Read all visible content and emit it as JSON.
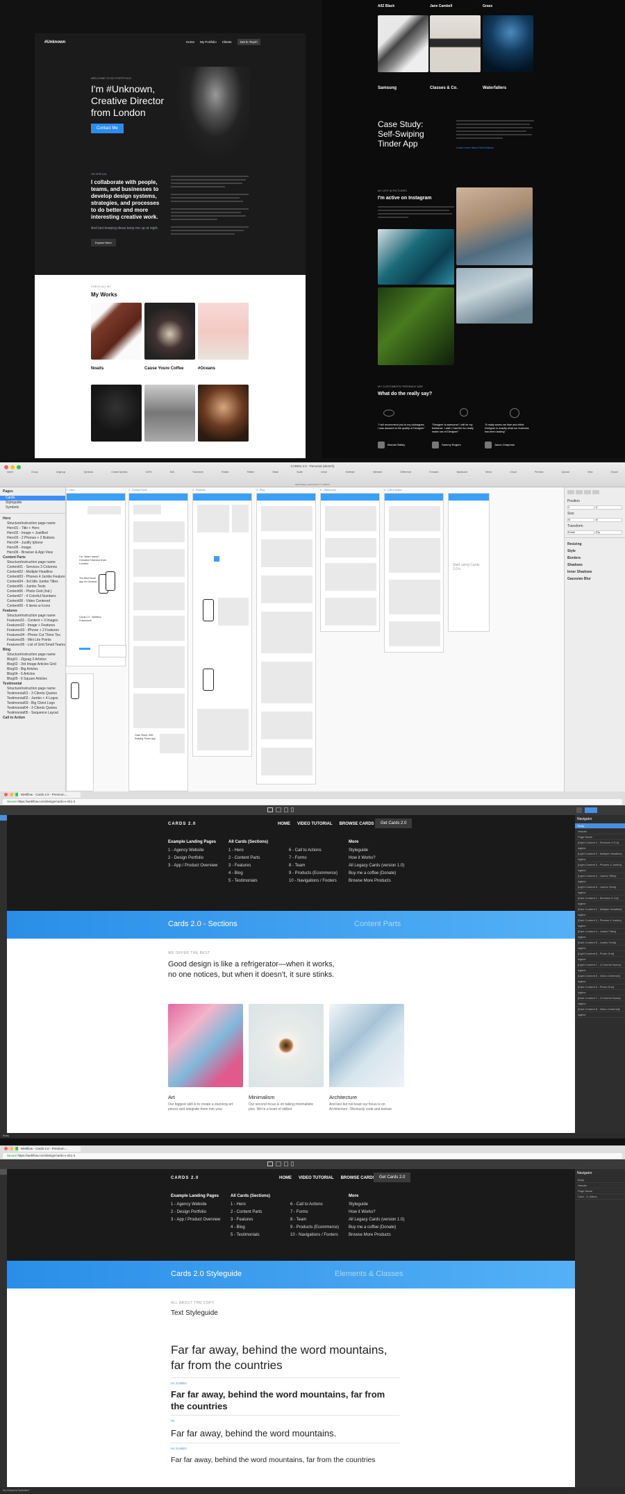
{
  "portfolio": {
    "brand": "#Unknown",
    "nav": [
      "Home",
      "My Portfolio",
      "Clients",
      "Get in Touch"
    ],
    "eyebrow": "WELCOME TO MY PORTFOLIO",
    "hero": "I'm #Unknown, Creative Director from London",
    "hero_btn": "Contact Me",
    "about_eyebrow": "I'M SPECIAL",
    "about_title": "I collaborate with people, teams, and businesses to develop design systems, strategies, and processes to do better and more interesting creative work.",
    "about_sub": "And last keeping ideas keep me up at night.",
    "about_btn": "Explore More",
    "works_eyebrow": "CHECK ALL MY",
    "works_title": "My Works",
    "works": [
      "Noaits",
      "Cause Youre Coffee",
      "#Oceans"
    ],
    "top_captions": [
      "A/IZ Black",
      "Jane Cambell",
      "Grass"
    ],
    "captions": [
      "Samsung",
      "Classes & Co.",
      "Waterfallers"
    ],
    "case_title": "Case Study: Self-Swiping Tinder App",
    "case_link": "Learn more about Self-Swipes",
    "insta_eyebrow": "MY LIFE IN PICTURES",
    "insta_title": "I'm active on Instagram",
    "reviews_eyebrow": "MY CUSTOMER'S FEEDBACK ARE",
    "reviews_title": "What do the really say?",
    "reviewers": [
      "Manuel Bailey",
      "Sammy Rogers",
      "Jason Chapman"
    ],
    "quotes": [
      "\"I will recommend you to my colleagues. I was amazed at the quality of Designer\"",
      "\"Designer is awesome! I will be my freelance. I wish I had the fun really made use of Designer\"",
      "\"It really saves me time and effort. Designer is exactly what our business has been lacking\""
    ]
  },
  "sketch": {
    "title": "CARDS 2.0 - Personal (Sketch)",
    "subtitle": "sketchapp.com/cards-2.0.sketch",
    "tools": [
      "Insert",
      "Group",
      "Ungroup",
      "Symbols",
      "Create Symbol",
      "Edit",
      "Transform",
      "Rotate",
      "Flatten",
      "Mask",
      "Scale",
      "Union",
      "Subtract",
      "Intersect",
      "Difference",
      "Forward",
      "Backward",
      "Mirror",
      "Cloud",
      "Preview",
      "Upload",
      "View",
      "Export"
    ],
    "zoom": "100%",
    "pages_label": "Pages",
    "pages": [
      "Cards",
      "Styleguide",
      "Symbols"
    ],
    "layers": [
      "Hero",
      "StructureInstruction page name",
      "Hero01 - Title + Hero",
      "Hero02 - Image + Justified",
      "Hero03 - 2 Phones + 2 Buttons",
      "Hero04 - Justify Iphone",
      "Hero05 - Image",
      "Hero06 - Browser & App View",
      "Content Parts",
      "StructureInstruction page name",
      "Content01 - Services 3 Columns",
      "Content02 - Multiple Headline",
      "Content03 - Phones 4 Jumbo Feature",
      "Content04 - 3rd Idle Jumbo Titles",
      "Content05 - Jumbo Texts",
      "Content06 - Photo Grid (Ind.)",
      "Content07 - 4 Colorful Numbers",
      "Content08 - Video Centered",
      "Content09 - 6 items w Icons",
      "Features",
      "StructureInstruction page name",
      "Features01 - Content + 3 Images",
      "Features02 - Image + Features",
      "Features03 - iPhone + 2 Features",
      "Features04 - Phone Cut Three Tex.",
      "Features05 - Mini Lite Points",
      "Features06 - List of Grid Small Teams",
      "Blog",
      "StructureInstruction page name",
      "Blog01 - Zigzag 3 Articles",
      "Blog02 - 3rd Image Articles Grid",
      "Blog03 - Big Articles",
      "Blog04 - 6 Articles",
      "Blog05 - 6 Square Articles",
      "Testimonial",
      "StructureInstruction page name",
      "Testimonial01 - 3 Clients Quotes",
      "Testimonial02 - Jumbo + 4 Logos",
      "Testimonial03 - Big Client Logo",
      "Testimonial04 - 3 Clients Quotes",
      "Testimonial05 - Sequence Layout",
      "Call to Action"
    ],
    "boards": [
      "1 - Hero",
      "2 - Content Parts",
      "3 - Features",
      "4 - Blog",
      "5 - Testimonial",
      "6 - Call to Action"
    ],
    "hero_text1": "I'm \"team name\" Creative Director from London",
    "hero_text2": "The Best Novel App for Demand",
    "hero_text3": "Cards 2.0 - Webflow Framework",
    "case_text": "Case Study: Self-Swiping Tinder app",
    "ghost_text": "Start using Cards 2.0 k",
    "inspector": [
      "Position",
      "Size",
      "Transform",
      "Resizing",
      "Style",
      "Borders",
      "Shadows",
      "Inner Shadows",
      "Gaussian Blur"
    ],
    "inspector_values": [
      "X",
      "Y",
      "W",
      "H",
      "Rotate",
      "Flip"
    ]
  },
  "webflow1": {
    "tab": "Webflow - Cards 2.0 - Premium ...",
    "url": "https://webflow.com/design/cards-v-sh1-2",
    "secure": "Secure",
    "brand": "CARDS 2.0",
    "nav": [
      "HOME",
      "VIDEO TUTORIAL",
      "BROWSE CARDS"
    ],
    "cta": "Get Cards 2.0",
    "col1_title": "Example Landing Pages",
    "col1": [
      "1 - Agency Website",
      "2 - Design Portfolio",
      "3 - App / Product Overview"
    ],
    "col2_title": "All Cards (Sections)",
    "col2a": [
      "1 - Hero",
      "2 - Content Parts",
      "3 - Features",
      "4 - Blog",
      "5 - Testimonials"
    ],
    "col2b": [
      "6 - Call to Actions",
      "7 - Forms",
      "8 - Team",
      "9 - Products (Ecommerce)",
      "10 - Navigations / Footers"
    ],
    "col3_title": "More",
    "col3": [
      "Styleguide",
      "How it Works?",
      "All Legacy Cards (version 1.0)",
      "Buy me a coffee (Donate)",
      "Browse More Products"
    ],
    "banner_left": "Cards 2.0 - Sections",
    "banner_right": "Content Parts",
    "eyebrow": "WE OFFER THE BEST",
    "headline": "Good design is like a refrigerator—when it works, no one notices, but when it doesn't, it sure stinks.",
    "cards": [
      "Art",
      "Minimalism",
      "Architecture"
    ],
    "card_texts": [
      "Our biggest skill is to create a stunning art pieces and integrate them into your",
      "Our second focus is on taking minimalistic pixs. We're a team of skilled",
      "And last but not least our focus is on Architecture. Obviously code and texture"
    ],
    "panel_title": "Navigator",
    "panel_items": [
      "Body",
      "Header",
      "Page Name",
      "[Light Content 1 - Services 3 Col]",
      "logline",
      "[Light Content 2 - Multiple Headline]",
      "logline",
      "[Light Content 3 - Phones 4 Jumbo]",
      "logline",
      "[Light Content 4 - Jumbo Titles]",
      "logline",
      "[Light Content 5 - Jumbo Texts]",
      "logline",
      "[Dark Content 1 - Services 3 Col]",
      "logline",
      "[Dark Content 2 - Multiple Headline]",
      "logline",
      "[Dark Content 3 - Phones 4 Jumbo]",
      "logline",
      "[Dark Content 4 - Jumbo Titles]",
      "logline",
      "[Dark Content 5 - Jumbo Texts]",
      "logline",
      "[Light Content 6 - Photo Grid]",
      "logline",
      "[Light Content 7 - 4 Colorful Nums]",
      "logline",
      "[Light Content 8 - Video Centered]",
      "logline",
      "[Dark Content 6 - Photo Grid]",
      "logline",
      "[Dark Content 7 - 4 Colorful Nums]",
      "logline",
      "[Dark Content 8 - Video Centered]",
      "logline"
    ],
    "status": "Body"
  },
  "webflow2": {
    "url": "https://webflow.com/design/cards-v-sh1-2",
    "banner_left": "Cards 2.0 Styleguide",
    "banner_right": "Elements & Classes",
    "eyebrow": "ALL ABOUT THE COPY",
    "title": "Text Styleguide",
    "h1": "Far far away, behind the word mountains, far from the countries",
    "label2": "H1 JUMBO",
    "h2": "Far far away, behind the word mountains, far from the countries",
    "label3": "H1",
    "h3": "Far far away, behind the word mountains.",
    "label4": "H2 JUMBO",
    "h4": "Far far away, behind the word mountains, far from the countries",
    "panel_items": [
      "Body",
      "Header",
      "Page Name",
      "Card - 2 | Menu"
    ],
    "status": "No Element Selected"
  }
}
